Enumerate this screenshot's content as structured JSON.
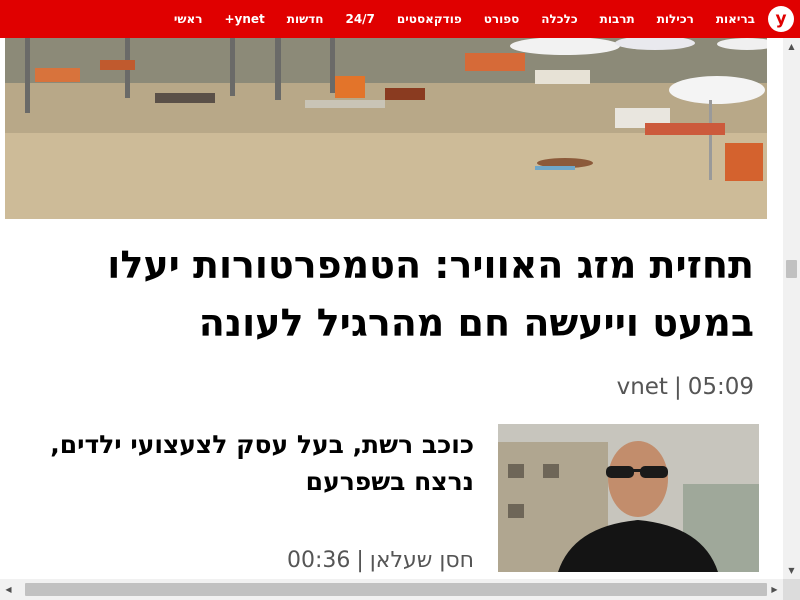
{
  "nav": {
    "logo_letter": "y",
    "items": [
      {
        "label": "ראשי",
        "active": false
      },
      {
        "label": "ynet+",
        "active": false
      },
      {
        "label": "חדשות",
        "active": true
      },
      {
        "label": "24/7",
        "active": false
      },
      {
        "label": "פודקאסטים",
        "active": false
      },
      {
        "label": "ספורט",
        "active": false
      },
      {
        "label": "כלכלה",
        "active": false
      },
      {
        "label": "תרבות",
        "active": false
      },
      {
        "label": "רכילות",
        "active": false
      },
      {
        "label": "בריאות",
        "active": false
      }
    ],
    "background": "#e00000"
  },
  "main_article": {
    "headline": "תחזית מזג האוויר: הטמפרטורות יעלו במעט וייעשה חם מהרגיל לעונה",
    "source": "vnet",
    "time": "05:09",
    "separator": "|"
  },
  "secondary_article": {
    "title": "כוכב רשת, בעל עסק לצעצועי ילדים, נרצח בשפרעם",
    "author": "חסן שעלאן",
    "time": "00:36",
    "separator": "|"
  },
  "scrollbars": {
    "vertical_position": 0.42,
    "horizontal_position": 0.5
  }
}
